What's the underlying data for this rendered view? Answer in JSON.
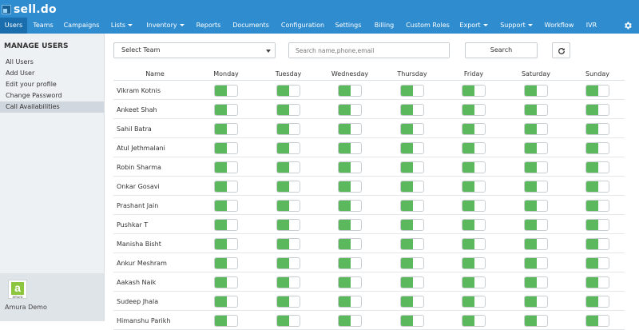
{
  "app": {
    "brand": "sell.do"
  },
  "nav": [
    {
      "label": "Users",
      "active": true,
      "dropdown": false
    },
    {
      "label": "Teams",
      "active": false,
      "dropdown": false
    },
    {
      "label": "Campaigns",
      "active": false,
      "dropdown": false
    },
    {
      "label": "Lists",
      "active": false,
      "dropdown": true
    },
    {
      "label": "Inventory",
      "active": false,
      "dropdown": true
    },
    {
      "label": "Reports",
      "active": false,
      "dropdown": false
    },
    {
      "label": "Documents",
      "active": false,
      "dropdown": false
    },
    {
      "label": "Configuration",
      "active": false,
      "dropdown": false
    },
    {
      "label": "Settings",
      "active": false,
      "dropdown": false
    },
    {
      "label": "Billing",
      "active": false,
      "dropdown": false
    },
    {
      "label": "Custom Roles",
      "active": false,
      "dropdown": false
    },
    {
      "label": "Export",
      "active": false,
      "dropdown": true
    },
    {
      "label": "Support",
      "active": false,
      "dropdown": true
    },
    {
      "label": "Workflow",
      "active": false,
      "dropdown": false
    },
    {
      "label": "IVR",
      "active": false,
      "dropdown": false
    }
  ],
  "sidebar": {
    "title": "MANAGE USERS",
    "items": [
      {
        "label": "All Users",
        "active": false
      },
      {
        "label": "Add User",
        "active": false
      },
      {
        "label": "Edit your profile",
        "active": false
      },
      {
        "label": "Change Password",
        "active": false
      },
      {
        "label": "Call Availabilities",
        "active": true
      }
    ],
    "company": "Amura Demo",
    "avatar_letter": "a",
    "avatar_caption": "amura"
  },
  "filters": {
    "team_select": "Select Team",
    "search_placeholder": "Search name,phone,email",
    "search_button": "Search"
  },
  "table": {
    "columns": [
      "Name",
      "Monday",
      "Tuesday",
      "Wednesday",
      "Thursday",
      "Friday",
      "Saturday",
      "Sunday"
    ],
    "rows": [
      {
        "name": "Vikram Kotnis",
        "availability": [
          true,
          true,
          true,
          true,
          true,
          true,
          true
        ]
      },
      {
        "name": "Ankeet Shah",
        "availability": [
          true,
          true,
          true,
          true,
          true,
          true,
          true
        ]
      },
      {
        "name": "Sahil Batra",
        "availability": [
          true,
          true,
          true,
          true,
          true,
          true,
          true
        ]
      },
      {
        "name": "Atul Jethmalani",
        "availability": [
          true,
          true,
          true,
          true,
          true,
          true,
          true
        ]
      },
      {
        "name": "Robin Sharma",
        "availability": [
          true,
          true,
          true,
          true,
          true,
          true,
          true
        ]
      },
      {
        "name": "Onkar Gosavi",
        "availability": [
          true,
          true,
          true,
          true,
          true,
          true,
          true
        ]
      },
      {
        "name": "Prashant Jain",
        "availability": [
          true,
          true,
          true,
          true,
          true,
          true,
          true
        ]
      },
      {
        "name": "Pushkar T",
        "availability": [
          true,
          true,
          true,
          true,
          true,
          true,
          true
        ]
      },
      {
        "name": "Manisha Bisht",
        "availability": [
          true,
          true,
          true,
          true,
          true,
          true,
          true
        ]
      },
      {
        "name": "Ankur Meshram",
        "availability": [
          true,
          true,
          true,
          true,
          true,
          true,
          true
        ]
      },
      {
        "name": "Aakash Naik",
        "availability": [
          true,
          true,
          true,
          true,
          true,
          true,
          true
        ]
      },
      {
        "name": "Sudeep Jhala",
        "availability": [
          true,
          true,
          true,
          true,
          true,
          true,
          true
        ]
      },
      {
        "name": "Himanshu Parikh",
        "availability": [
          true,
          true,
          true,
          true,
          true,
          true,
          true
        ]
      }
    ]
  },
  "colors": {
    "topbar": "#2f8ccf",
    "active_nav": "#1b6eae",
    "toggle_on": "#5cb85c"
  }
}
